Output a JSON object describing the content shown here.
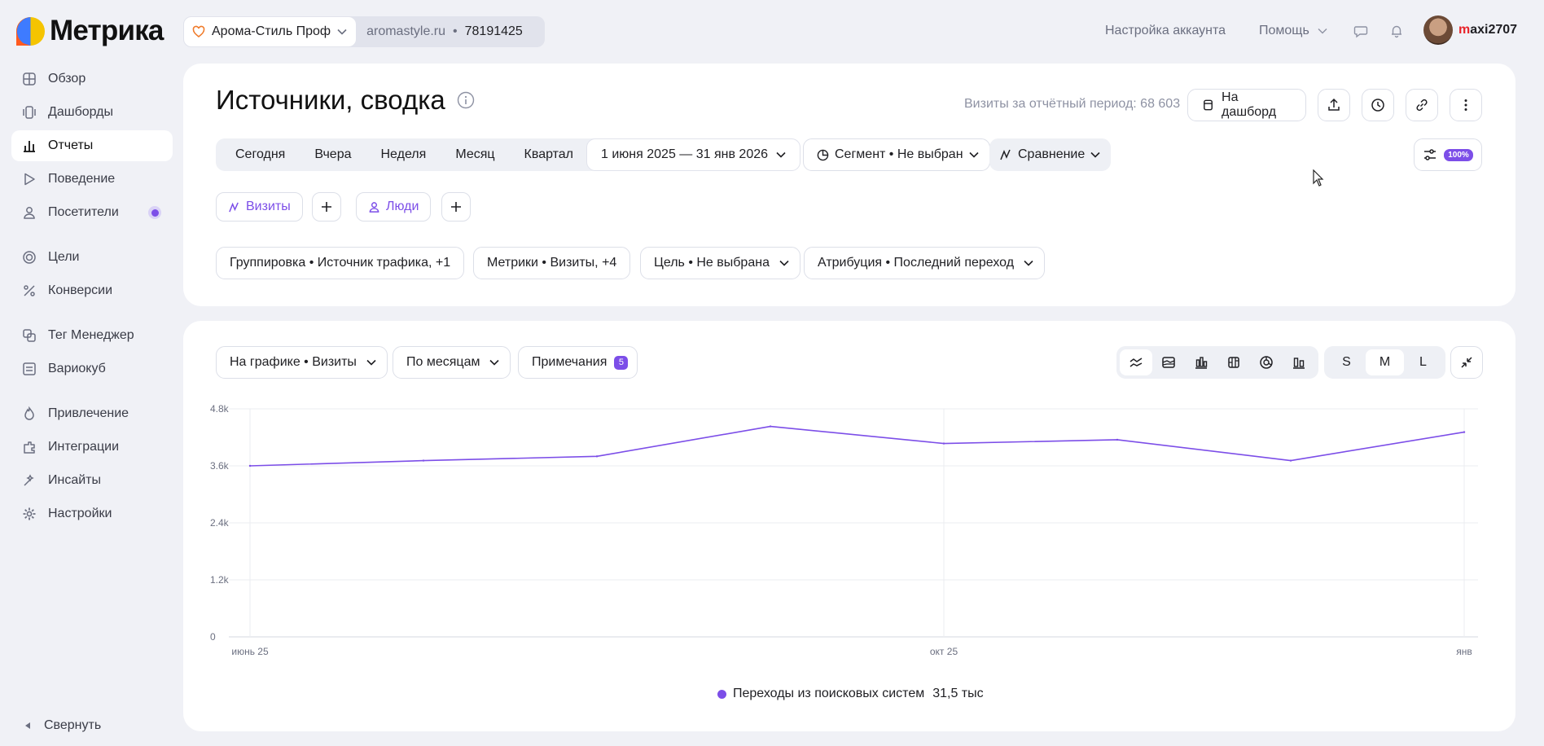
{
  "app": {
    "logo_text": "Метрика"
  },
  "counter": {
    "name": "Арома-Стиль Проф",
    "site": "aromastyle.ru",
    "separator": "•",
    "id": "78191425"
  },
  "topnav": {
    "account_settings": "Настройка аккаунта",
    "help": "Помощь"
  },
  "user": {
    "first_letter": "m",
    "rest": "axi2707"
  },
  "sidebar": {
    "items": [
      {
        "label": "Обзор",
        "icon": "overview-icon"
      },
      {
        "label": "Дашборды",
        "icon": "dashboards-icon"
      },
      {
        "label": "Отчеты",
        "icon": "reports-icon",
        "active": true
      },
      {
        "label": "Поведение",
        "icon": "behavior-icon"
      },
      {
        "label": "Посетители",
        "icon": "visitors-icon"
      },
      {
        "label": "Цели",
        "icon": "goals-icon"
      },
      {
        "label": "Конверсии",
        "icon": "conversions-icon"
      },
      {
        "label": "Тег Менеджер",
        "icon": "tag-manager-icon"
      },
      {
        "label": "Вариокуб",
        "icon": "variocube-icon"
      },
      {
        "label": "Привлечение",
        "icon": "acquisition-icon"
      },
      {
        "label": "Интеграции",
        "icon": "integrations-icon"
      },
      {
        "label": "Инсайты",
        "icon": "insights-icon"
      },
      {
        "label": "Настройки",
        "icon": "settings-icon"
      }
    ],
    "collapse_label": "Свернуть"
  },
  "report": {
    "title": "Источники, сводка",
    "visits_total_label": "Визиты за отчётный период: 68 603",
    "to_dashboard": "На дашборд",
    "periods": [
      "Сегодня",
      "Вчера",
      "Неделя",
      "Месяц",
      "Квартал"
    ],
    "date_range": "1 июня 2025 — 31 янв 2026",
    "segment": "Сегмент • Не выбран",
    "comparison": "Сравнение",
    "sampling": "100%",
    "filters": {
      "visits": "Визиты",
      "people": "Люди"
    },
    "grouping": "Группировка • Источник трафика, +1",
    "metrics": "Метрики • Визиты, +4",
    "goal": "Цель • Не выбрана",
    "attribution": "Атрибуция • Последний переход"
  },
  "chart_panel": {
    "metric_select": "На графике • Визиты",
    "detail_select": "По месяцам",
    "notes_label": "Примечания",
    "notes_count": "5",
    "sizes": [
      "S",
      "M",
      "L"
    ],
    "active_size": "M"
  },
  "chart_data": {
    "type": "line",
    "x": [
      "2025-06",
      "2025-07",
      "2025-08",
      "2025-09",
      "2025-10",
      "2025-11",
      "2025-12",
      "2026-01"
    ],
    "series": [
      {
        "name": "Переходы из поисковых систем",
        "total_label": "31,5 тыс",
        "color": "#7c4ee8",
        "values": [
          3600,
          3710,
          3800,
          4430,
          4070,
          4150,
          3710,
          4310
        ]
      }
    ],
    "ylim": [
      0,
      4800
    ],
    "yticks": [
      0,
      1200,
      2400,
      3600,
      4800
    ],
    "ytick_labels": [
      "0",
      "1.2k",
      "2.4k",
      "3.6k",
      "4.8k"
    ],
    "xtick_labels": [
      {
        "label": "июнь 25",
        "index": 0
      },
      {
        "label": "окт 25",
        "index": 4
      },
      {
        "label": "янв",
        "index": 7
      }
    ],
    "grid": true
  }
}
